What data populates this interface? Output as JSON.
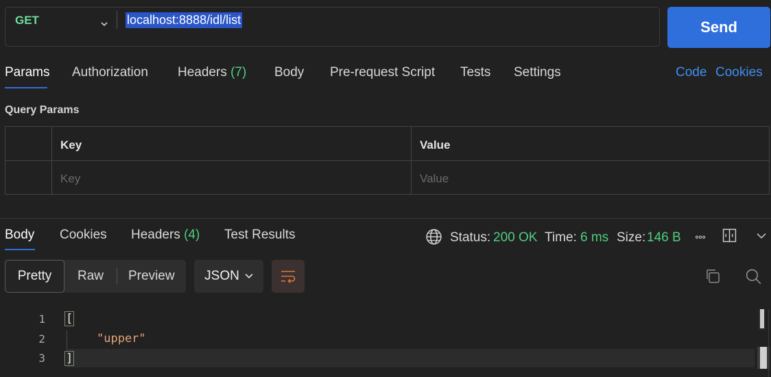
{
  "request": {
    "method": "GET",
    "url": "localhost:8888/idl/list",
    "send_label": "Send"
  },
  "request_tabs": {
    "params": "Params",
    "authorization": "Authorization",
    "headers": "Headers",
    "headers_count": "(7)",
    "body": "Body",
    "prerequest": "Pre-request Script",
    "tests": "Tests",
    "settings": "Settings",
    "code": "Code",
    "cookies": "Cookies"
  },
  "query_params": {
    "label": "Query Params",
    "key_header": "Key",
    "value_header": "Value",
    "key_placeholder": "Key",
    "value_placeholder": "Value"
  },
  "response_tabs": {
    "body": "Body",
    "cookies": "Cookies",
    "headers": "Headers",
    "headers_count": "(4)",
    "test_results": "Test Results"
  },
  "response_status": {
    "status_label": "Status:",
    "status_value": "200 OK",
    "time_label": "Time:",
    "time_value": "6 ms",
    "size_label": "Size:",
    "size_value": "146 B"
  },
  "response_toolbar": {
    "pretty": "Pretty",
    "raw": "Raw",
    "preview": "Preview",
    "format": "JSON"
  },
  "response_body": {
    "line_numbers": [
      "1",
      "2",
      "3"
    ],
    "line1": "[",
    "line2": "\"upper\"",
    "line3": "]"
  },
  "colors": {
    "accent_blue": "#2f6fdc",
    "success_green": "#4fcf7f",
    "string_orange": "#e3a278"
  }
}
